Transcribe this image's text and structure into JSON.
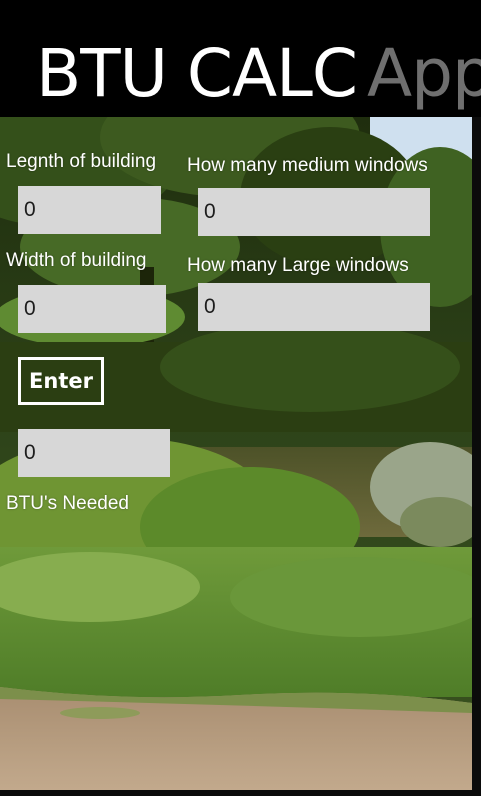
{
  "app": {
    "title": "BTU CALC",
    "subtitle": "App"
  },
  "form": {
    "length_label": "Legnth of building",
    "length_value": "0",
    "width_label": "Width of building",
    "width_value": "0",
    "medium_windows_label": "How many medium windows",
    "medium_windows_value": "0",
    "large_windows_label": "How many Large windows",
    "large_windows_value": "0",
    "enter_label": "Enter",
    "result_value": "0",
    "result_label": "BTU's  Needed"
  },
  "background": {
    "description_icon": "park-pond-photo-background",
    "colors": {
      "sky": "#cfe0ef",
      "foliage_dark": "#24370f",
      "foliage_mid": "#4a6a25",
      "water": "#5f5e33",
      "grass": "#5e8b2d",
      "dirt": "#b59a7c"
    }
  },
  "colors": {
    "title_bar": "#000000",
    "title_text": "#ffffff",
    "subtitle_text": "#6f6f6f",
    "field_bg": "#d7d7d7",
    "label_text": "#ffffff"
  }
}
